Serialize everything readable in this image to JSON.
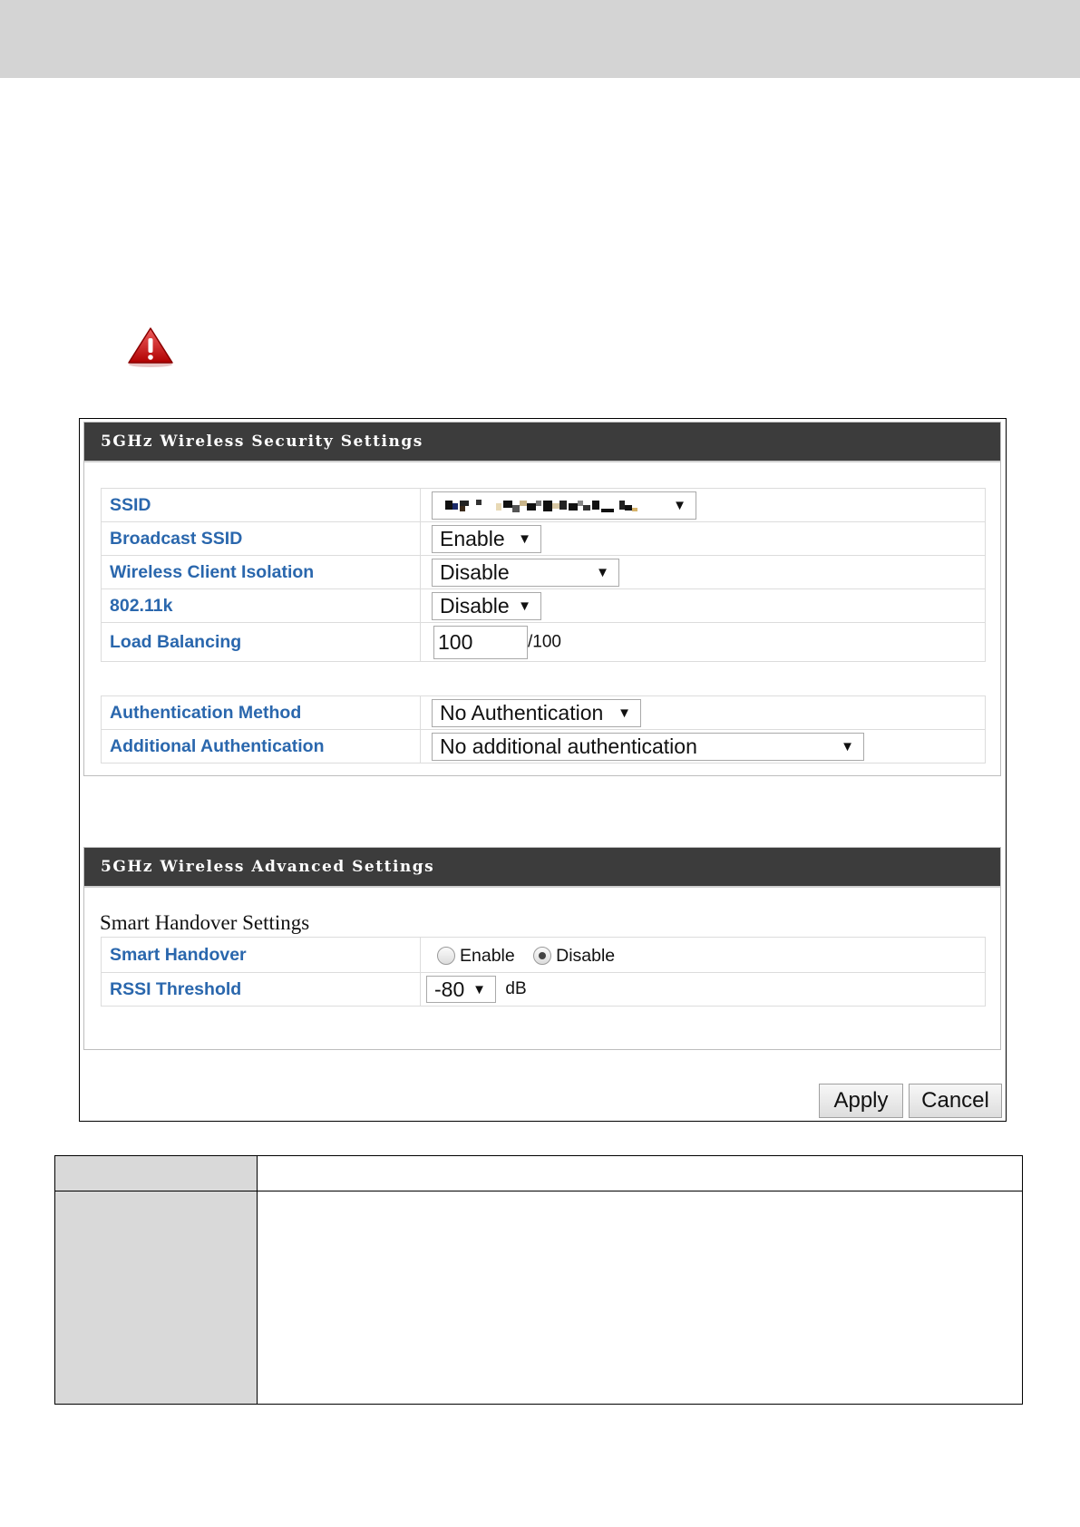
{
  "security": {
    "title": "5GHz Wireless Security Settings",
    "ssid_label": "SSID",
    "broadcast_label": "Broadcast SSID",
    "broadcast_value": "Enable",
    "isolation_label": "Wireless Client Isolation",
    "isolation_value": "Disable",
    "k_label": "802.11k",
    "k_value": "Disable",
    "load_label": "Load Balancing",
    "load_value": "100",
    "load_unit": "/100",
    "auth_label": "Authentication Method",
    "auth_value": "No Authentication",
    "add_auth_label": "Additional Authentication",
    "add_auth_value": "No additional authentication"
  },
  "advanced": {
    "title": "5GHz Wireless Advanced Settings",
    "subtitle": "Smart Handover Settings",
    "handover_label": "Smart Handover",
    "enable_label": "Enable",
    "disable_label": "Disable",
    "selected": "Disable",
    "rssi_label": "RSSI Threshold",
    "rssi_value": "-80",
    "rssi_unit": "dB"
  },
  "buttons": {
    "apply": "Apply",
    "cancel": "Cancel"
  },
  "icons": {
    "warning": "warning-icon",
    "dropdown": "dropdown-arrow-icon"
  },
  "colors": {
    "label_blue": "#2a67ad",
    "header_dark": "#3c3c3c",
    "topbar_gray": "#d4d4d4"
  }
}
